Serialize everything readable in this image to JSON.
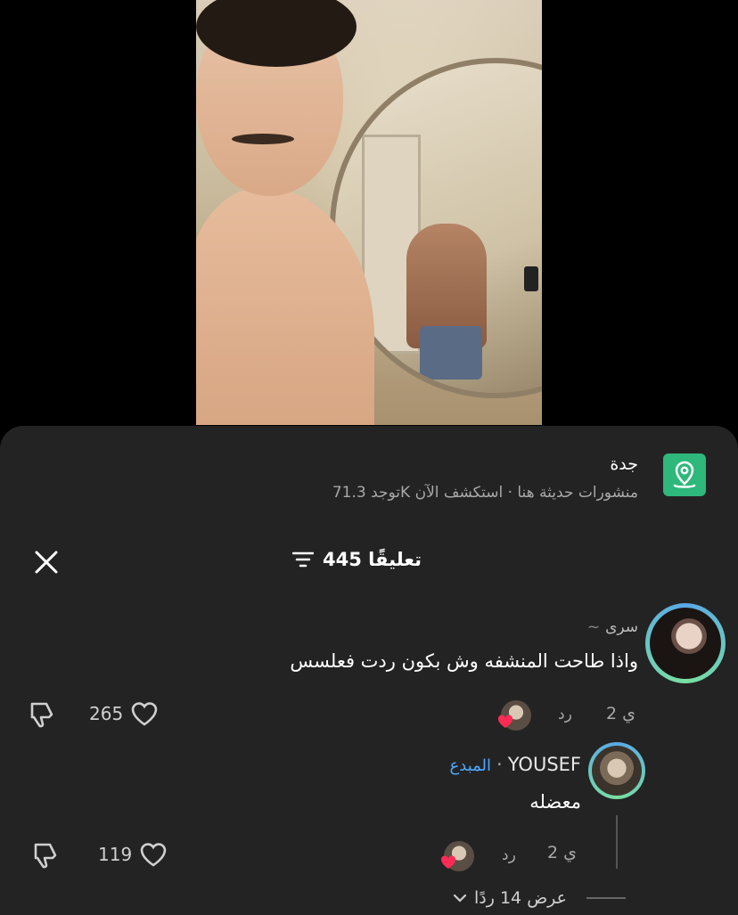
{
  "location": {
    "title": "جدة",
    "subtitle": "توجد 71.3K منشورات حديثة هنا · استكشف الآن",
    "icon": "location-pin-icon",
    "accent": "#2eb87b"
  },
  "comments_header": {
    "count_label": "445 تعليقًا",
    "filter_icon": "filter-icon",
    "close_icon": "close-icon"
  },
  "comments": [
    {
      "author": "سرى",
      "author_decoration": "~",
      "text": "واذا طاحت المنشفه وش بكون ردت فعلسس",
      "time": "2 ي",
      "reply_label": "رد",
      "likes": "265"
    }
  ],
  "reply": {
    "author": "YOUSEF",
    "creator_badge": "المبدع",
    "text": "معضله",
    "time": "2 ي",
    "reply_label": "رد",
    "likes": "119"
  },
  "view_more": {
    "label": "عرض 14 ردًا"
  }
}
